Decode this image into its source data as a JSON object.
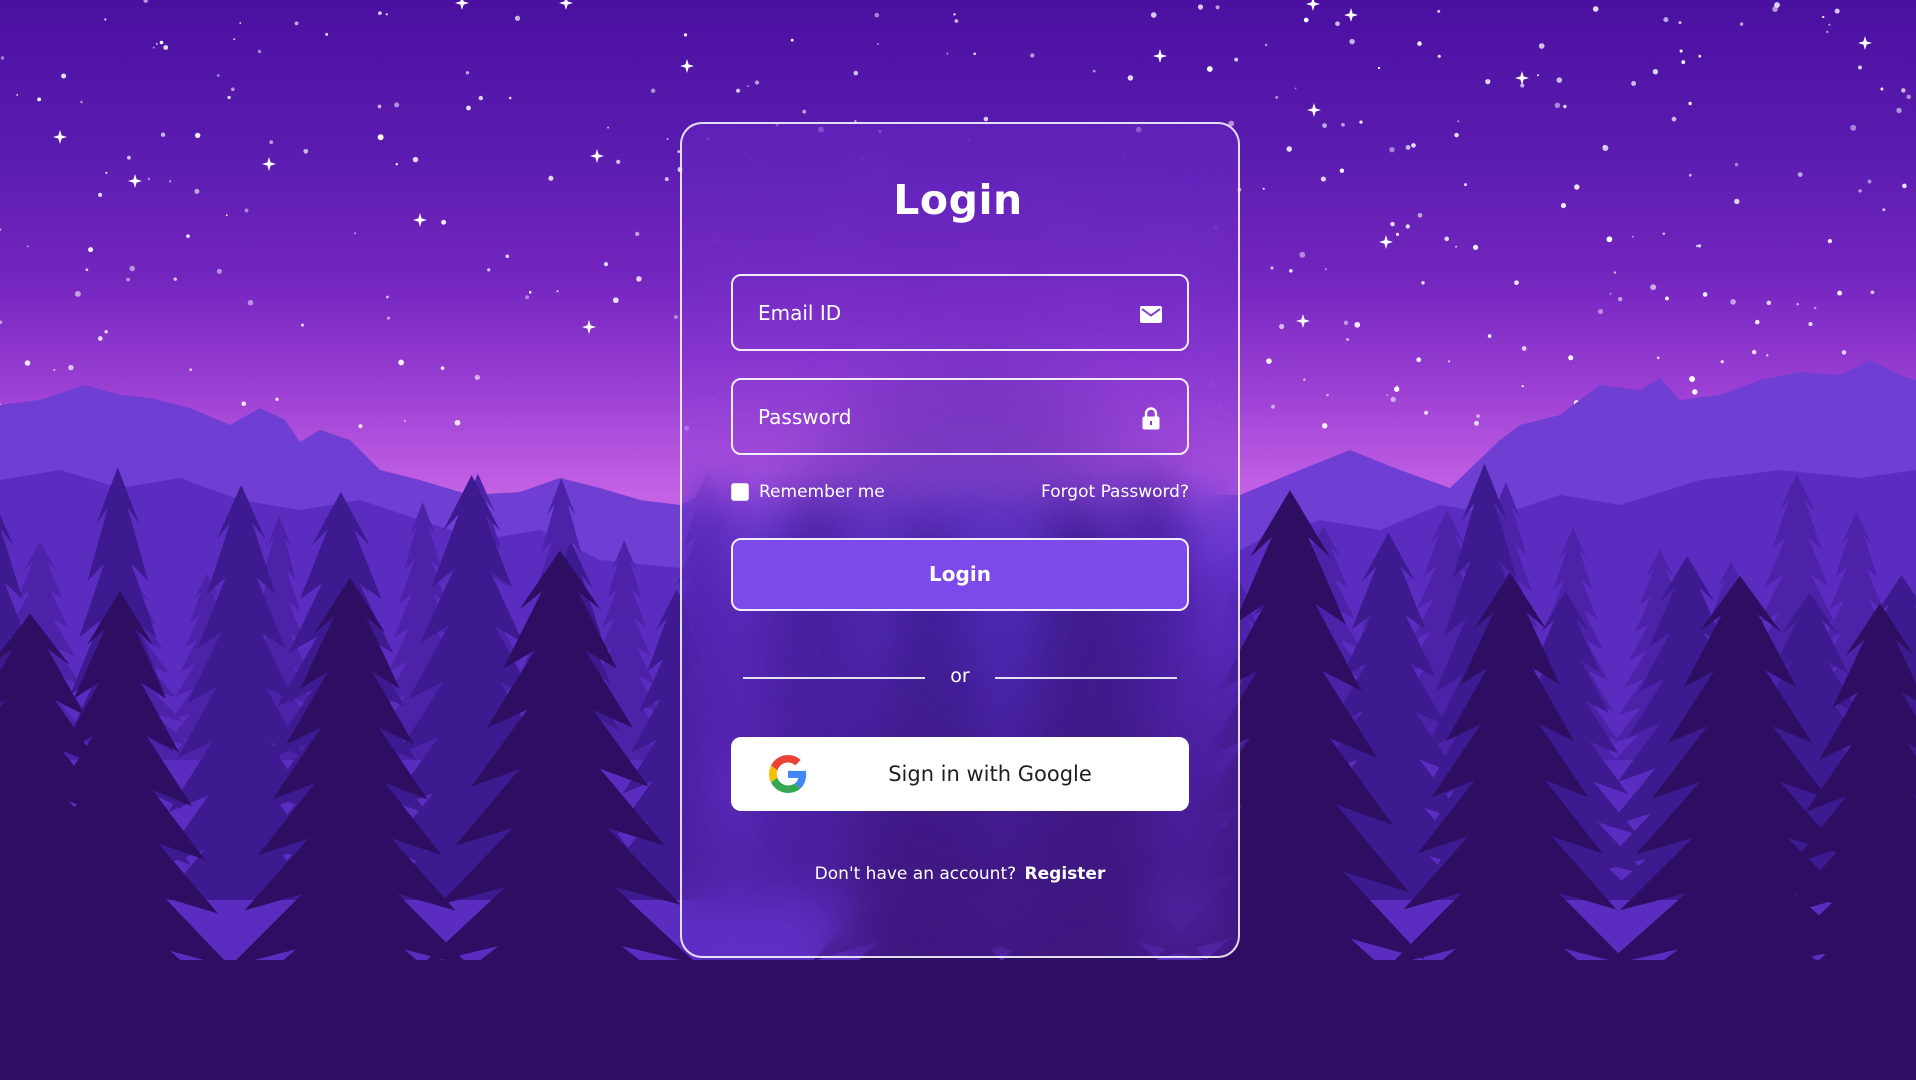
{
  "login": {
    "title": "Login",
    "email_placeholder": "Email ID",
    "password_placeholder": "Password",
    "remember_label": "Remember me",
    "forgot_label": "Forgot Password?",
    "login_button": "Login",
    "divider_text": "or",
    "google_button": "Sign in with Google",
    "register_prompt": "Don't have an account?",
    "register_link": "Register"
  },
  "icons": {
    "email": "envelope-icon",
    "password": "lock-icon",
    "google": "google-logo-icon"
  },
  "colors": {
    "sky_top": "#4a10a0",
    "horizon": "#c563e6",
    "button": "#7b4ae8",
    "forest_dark": "#2e0e63"
  }
}
